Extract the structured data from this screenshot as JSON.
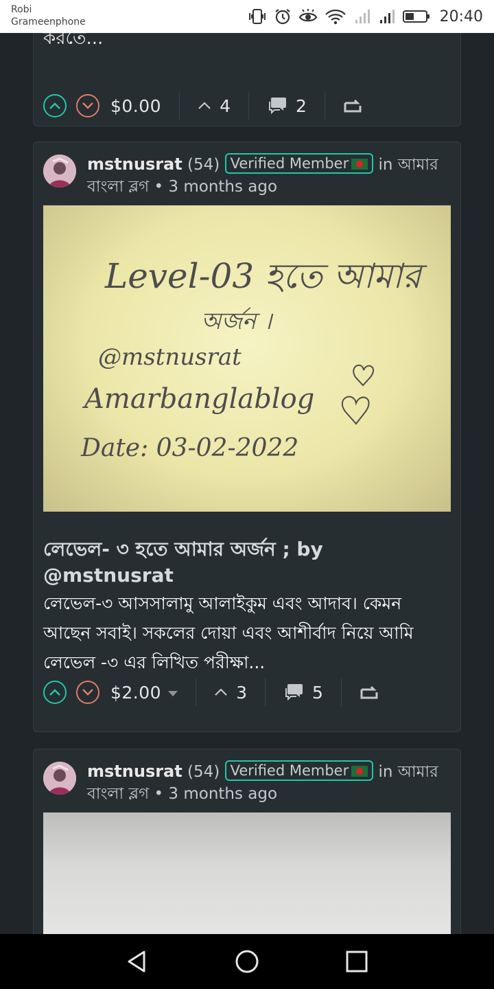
{
  "status_bar": {
    "carrier_line1": "Robi",
    "carrier_line2": "Grameenphone",
    "time": "20:40"
  },
  "posts": [
    {
      "snippet_tail": "করতে...",
      "payout": "$0.00",
      "votes": "4",
      "comments": "2"
    },
    {
      "author": "mstnusrat",
      "reputation": "(54)",
      "badge": "Verified Member",
      "community_prefix": "in আমার",
      "community_rest": "বাংলা ব্লগ",
      "age": "3 months ago",
      "image_text": {
        "line1": "Level-03 হতে আমার",
        "line2": "অর্জন ।",
        "line3": "@mstnusrat",
        "line4": "Amarbanglablog",
        "line5": "Date: 03-02-2022"
      },
      "title": "লেভেল- ৩ হতে আমার অর্জন ; by @mstnusrat",
      "summary": "লেভেল-৩ আসসালামু আলাইকুম এবং আদাব। কেমন আছেন সবাই। সকলের দোয়া এবং আশীর্বাদ নিয়ে আমি লেভেল -৩ এর লিখিত পরীক্ষা...",
      "payout": "$2.00",
      "votes": "3",
      "comments": "5"
    },
    {
      "author": "mstnusrat",
      "reputation": "(54)",
      "badge": "Verified Member",
      "community_prefix": "in আমার",
      "community_rest": "বাংলা ব্লগ",
      "age": "3 months ago"
    }
  ],
  "icons": {
    "upvote": "chevron-up-circle-icon",
    "downvote": "chevron-down-circle-icon",
    "votes": "chevron-up-icon",
    "comments": "comment-bubbles-icon",
    "reblog": "reblog-icon"
  },
  "colors": {
    "background": "#1f2528",
    "card": "#262e31",
    "accent": "#21c7a8",
    "downvote": "#e07b6b"
  }
}
